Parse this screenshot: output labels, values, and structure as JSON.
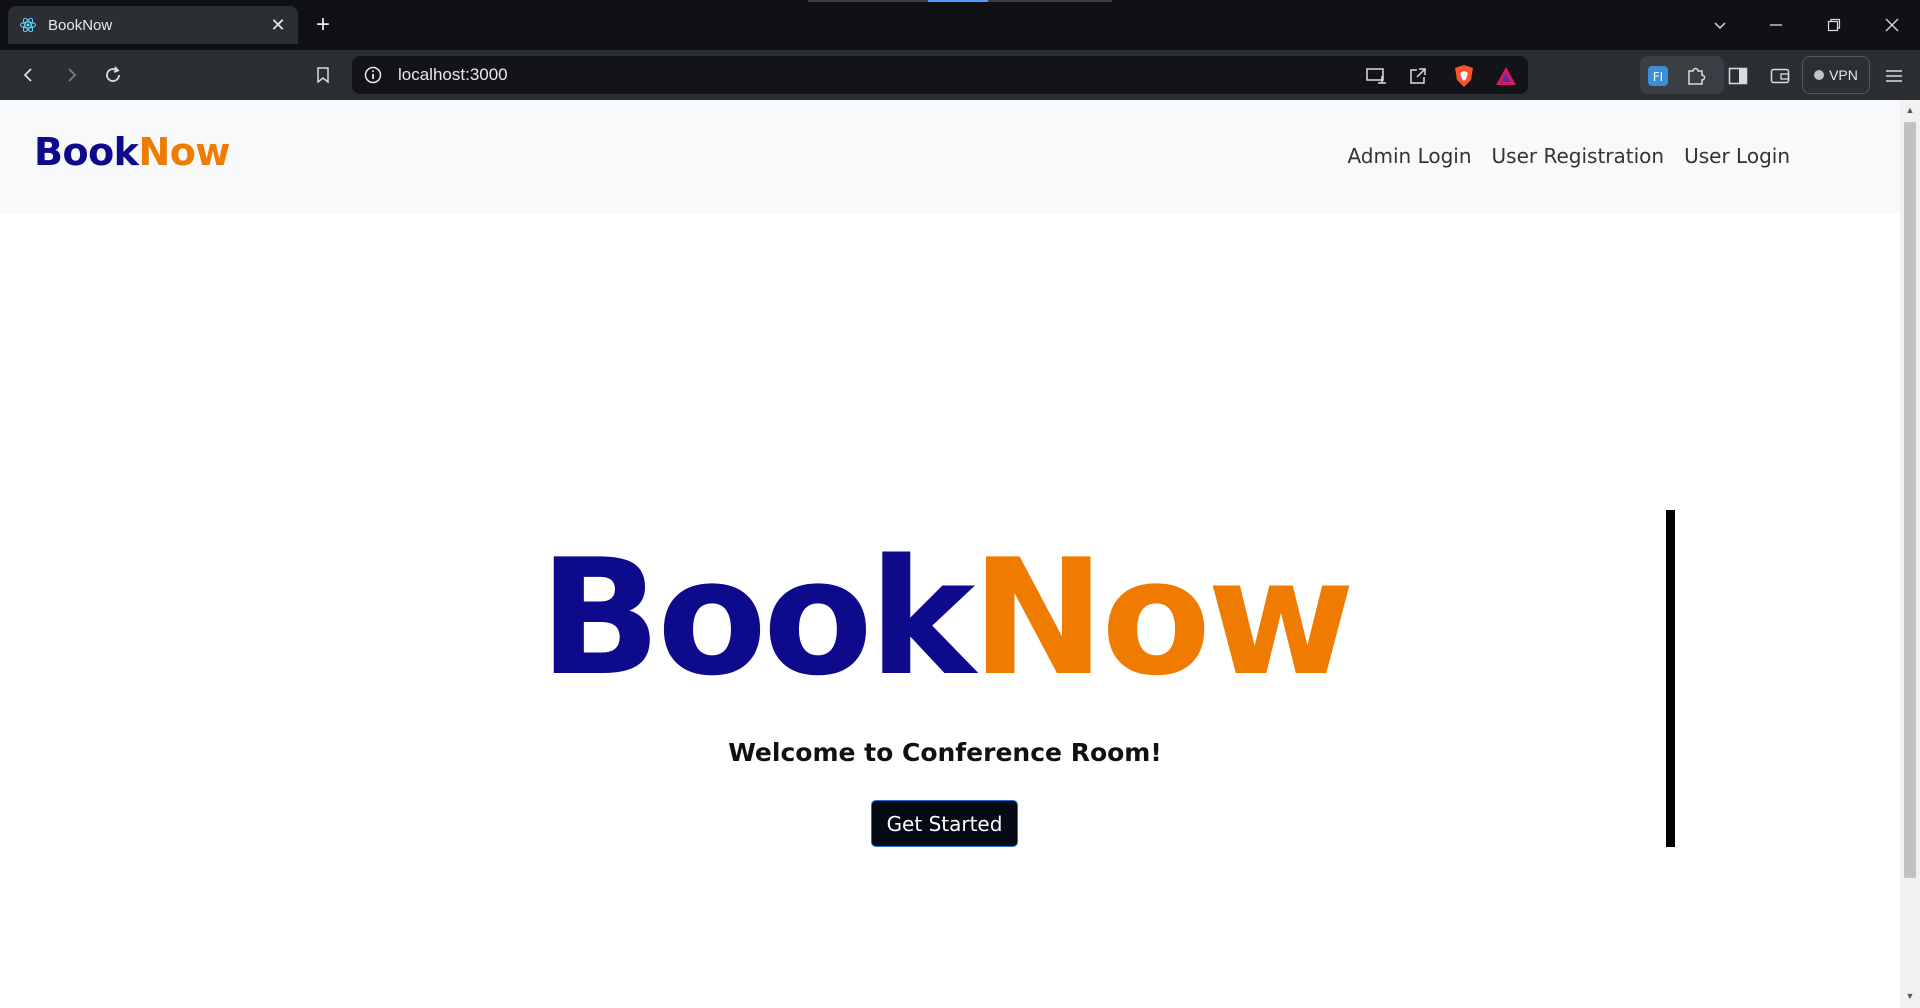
{
  "browser": {
    "tab": {
      "title": "BookNow",
      "favicon": "react-icon"
    },
    "address_bar": {
      "url": "localhost:3000"
    },
    "vpn_label": "VPN"
  },
  "navbar": {
    "brand": {
      "part1": "Book",
      "part2": "Now"
    },
    "links": [
      "Admin Login",
      "User Registration",
      "User Login"
    ]
  },
  "hero": {
    "title_part1": "Book",
    "title_part2": "Now",
    "subtitle": "Welcome to Conference Room!",
    "cta_label": "Get Started"
  },
  "colors": {
    "brand_blue": "#0d0a8c",
    "brand_orange": "#ef7c00",
    "button_bg": "#050a14",
    "button_border": "#1e6fd9"
  }
}
